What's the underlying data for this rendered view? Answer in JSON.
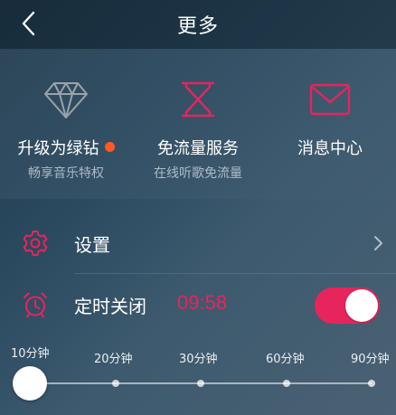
{
  "header": {
    "title": "更多"
  },
  "features": [
    {
      "label": "升级为绿钻",
      "sub": "畅享音乐特权",
      "icon": "diamond-icon",
      "has_badge": true
    },
    {
      "label": "免流量服务",
      "sub": "在线听歌免流量",
      "icon": "hourglass-icon",
      "has_badge": false
    },
    {
      "label": "消息中心",
      "sub": "",
      "icon": "envelope-icon",
      "has_badge": false
    }
  ],
  "settings": {
    "label": "设置"
  },
  "timer": {
    "label": "定时关闭",
    "value": "09:58",
    "enabled": true
  },
  "slider": {
    "options": [
      "10分钟",
      "20分钟",
      "30分钟",
      "60分钟",
      "90分钟"
    ],
    "selected_index": 0
  },
  "colors": {
    "accent": "#e8245d",
    "badge": "#ff5a1f"
  }
}
